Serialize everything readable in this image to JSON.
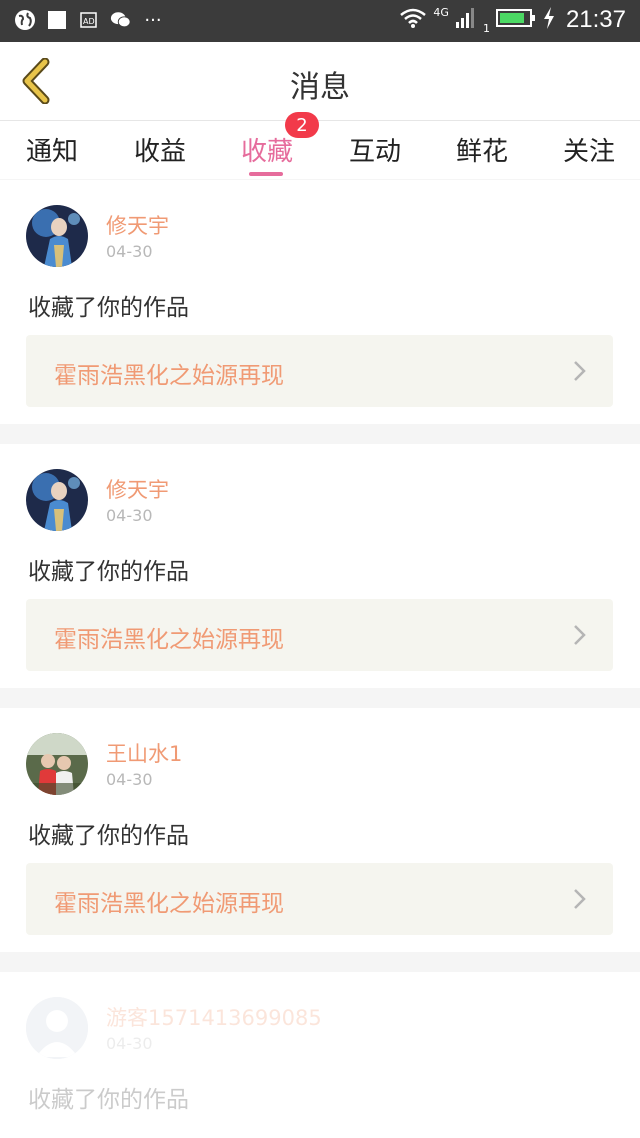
{
  "status_bar": {
    "time": "21:37",
    "network": "4G",
    "sim": "1",
    "more": "···",
    "battery_color": "#4cd964"
  },
  "header": {
    "title": "消息",
    "accent": "#e66c9c"
  },
  "tabs": [
    {
      "label": "通知",
      "active": false
    },
    {
      "label": "收益",
      "active": false
    },
    {
      "label": "收藏",
      "active": true,
      "badge": "2"
    },
    {
      "label": "互动",
      "active": false
    },
    {
      "label": "鲜花",
      "active": false
    },
    {
      "label": "关注",
      "active": false
    }
  ],
  "messages": [
    {
      "user": "修天宇",
      "date": "04-30",
      "action": "收藏了你的作品",
      "work": "霍雨浩黑化之始源再现",
      "avatar": "anime-avatar"
    },
    {
      "user": "修天宇",
      "date": "04-30",
      "action": "收藏了你的作品",
      "work": "霍雨浩黑化之始源再现",
      "avatar": "anime-avatar"
    },
    {
      "user": "王山水1",
      "date": "04-30",
      "action": "收藏了你的作品",
      "work": "霍雨浩黑化之始源再现",
      "avatar": "photo-avatar"
    },
    {
      "user": "游客1571413699085",
      "date": "04-30",
      "action": "收藏了你的作品",
      "avatar": "default-avatar"
    }
  ]
}
